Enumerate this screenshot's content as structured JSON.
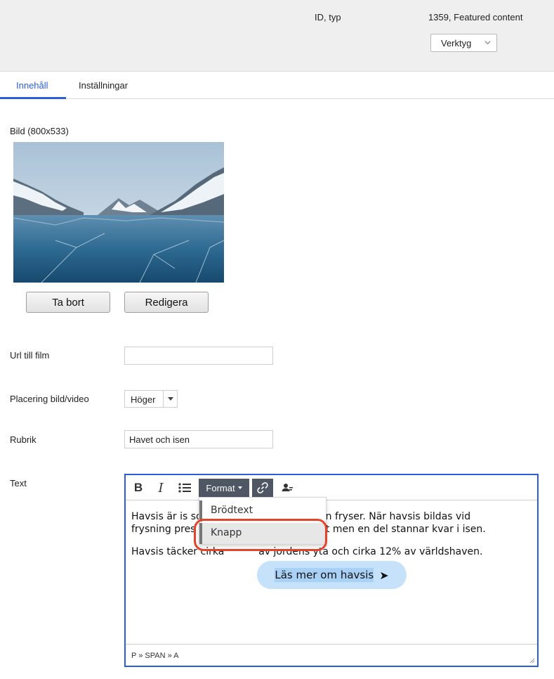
{
  "header": {
    "meta_label": "ID, typ",
    "meta_value": "1359, Featured content",
    "tools_label": "Verktyg"
  },
  "tabs": [
    {
      "label": "Innehåll",
      "active": true
    },
    {
      "label": "Inställningar",
      "active": false
    }
  ],
  "image_field": {
    "label": "Bild (800x533)",
    "remove_label": "Ta bort",
    "edit_label": "Redigera"
  },
  "film_field": {
    "label": "Url till film",
    "value": ""
  },
  "placement_field": {
    "label": "Placering bild/video",
    "value": "Höger"
  },
  "headline_field": {
    "label": "Rubrik",
    "value": "Havet och isen"
  },
  "text_field": {
    "label": "Text",
    "toolbar": {
      "bold": "B",
      "italic": "I",
      "list_icon": "bullet-list-icon",
      "format_label": "Format",
      "link_icon": "link-icon",
      "person_icon": "person-icon"
    },
    "paragraph1_line1_start": "Havsis är is so",
    "paragraph1_line1_end": "vsvatten fryser. När havsis bildas vid",
    "paragraph1_line2_start": "frysning pres",
    "paragraph1_line2_end": "et ut men en del stannar kvar i isen.",
    "paragraph2_start": "Havsis täcker cirka ",
    "paragraph2_end": " av jordens yta och cirka 12% av världshaven.",
    "cta_label": "Läs mer om havsis",
    "cta_arrow": "➤",
    "statusbar": "P » SPAN » A"
  },
  "format_dropdown": {
    "items": [
      "Brödtext",
      "Knapp"
    ],
    "highlighted": "Knapp"
  },
  "colors": {
    "accent": "#2b5fd9",
    "highlight_ring": "#e2452c",
    "toolbar_active": "#4e5763",
    "cta_bg": "#c6e2fa"
  }
}
